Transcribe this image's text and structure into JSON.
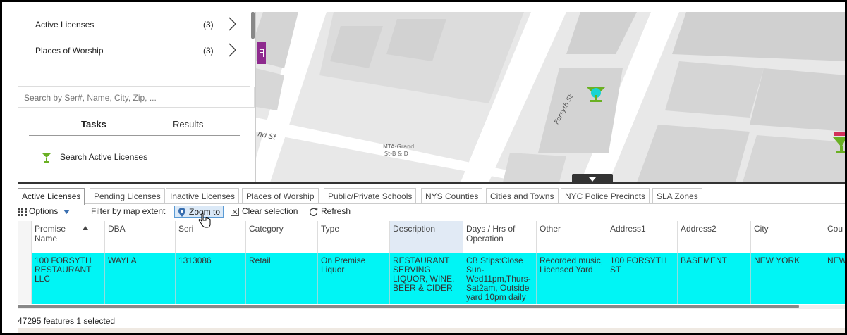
{
  "layer_list": {
    "items": [
      {
        "name": "Active Licenses",
        "count": "(3)"
      },
      {
        "name": "Places of Worship",
        "count": "(3)"
      }
    ]
  },
  "search": {
    "placeholder": "Search by Ser#, Name, City, Zip, ..."
  },
  "panel_tabs": {
    "tasks": "Tasks",
    "results": "Results"
  },
  "tasks": {
    "search_active_licenses": "Search Active Licenses"
  },
  "map": {
    "street_1": "nd St",
    "street_2": "Forsyth St",
    "station_line1": "MTA-Grand",
    "station_line2": "St-B & D"
  },
  "attr_tabs": [
    "Active Licenses",
    "Pending Licenses",
    "Inactive Licenses",
    "Places of Worship",
    "Public/Private Schools",
    "NYS Counties",
    "Cities and Towns",
    "NYC Police Precincts",
    "SLA Zones"
  ],
  "toolbar": {
    "options": "Options",
    "filter": "Filter by map extent",
    "zoom": "Zoom to",
    "clear": "Clear selection",
    "refresh": "Refresh"
  },
  "grid": {
    "columns": [
      "Premise Name",
      "DBA",
      "Serial",
      "Category",
      "Type",
      "Description",
      "Days / Hrs of Operation",
      "Other",
      "Address1",
      "Address2",
      "City",
      "County"
    ],
    "column_display": [
      "Premise\nName",
      "DBA",
      "Seri",
      "Category",
      "Type",
      "Description",
      "Days / Hrs of\nOperation",
      "Other",
      "Address1",
      "Address2",
      "City",
      "Cou"
    ],
    "rows": [
      [
        "100 FORSYTH RESTAURANT LLC",
        "WAYLA",
        "1313086",
        "Retail",
        "On Premise Liquor",
        "RESTAURANT SERVING LIQUOR, WINE, BEER & CIDER",
        "CB Stips:Close Sun-Wed11pm,Thurs-Sat2am, Outside yard 10pm daily",
        "Recorded music, Licensed Yard",
        "100 FORSYTH ST",
        "BASEMENT",
        "NEW YORK",
        "NEW"
      ]
    ]
  },
  "status": {
    "text": "47295 features  1 selected"
  },
  "colors": {
    "selected_row": "#00f5f5",
    "map_bg": "#e8e8e8",
    "building": "#d6d6d6",
    "accent_green": "#6ab023",
    "marker_purple": "#8e2a8e"
  }
}
